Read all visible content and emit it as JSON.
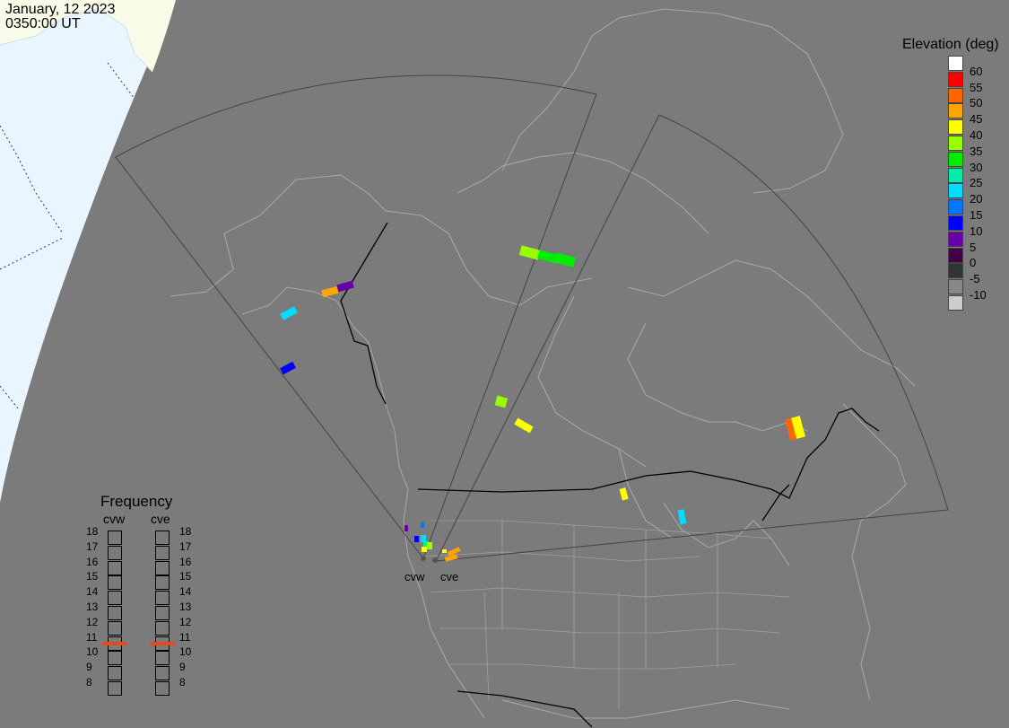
{
  "header": {
    "date": "January, 12 2023",
    "time": "0350:00 UT"
  },
  "elevation_legend": {
    "title": "Elevation (deg)",
    "items": [
      {
        "label": "60",
        "color": "#ffffff"
      },
      {
        "label": "55",
        "color": "#ff0000"
      },
      {
        "label": "50",
        "color": "#ff6600"
      },
      {
        "label": "45",
        "color": "#ffa500"
      },
      {
        "label": "40",
        "color": "#ffff00"
      },
      {
        "label": "35",
        "color": "#99ff00"
      },
      {
        "label": "30",
        "color": "#00ee00"
      },
      {
        "label": "25",
        "color": "#00eeaa"
      },
      {
        "label": "20",
        "color": "#00ddff"
      },
      {
        "label": "15",
        "color": "#0077ff"
      },
      {
        "label": "10",
        "color": "#0000ff"
      },
      {
        "label": "5",
        "color": "#6600aa"
      },
      {
        "label": "0",
        "color": "#440044"
      },
      {
        "label": "-5",
        "color": "#333333"
      },
      {
        "label": "-10",
        "color": "#888888"
      },
      {
        "label": "",
        "color": "#cccccc"
      }
    ]
  },
  "frequency_legend": {
    "title": "Frequency",
    "columns": [
      {
        "name": "cvw",
        "selected": "11"
      },
      {
        "name": "cve",
        "selected": "11"
      }
    ],
    "levels": [
      "18",
      "17",
      "16",
      "15",
      "14",
      "13",
      "12",
      "11",
      "10",
      "9",
      "8"
    ],
    "marker_color": "#e8481c"
  },
  "radars": [
    {
      "name": "cvw"
    },
    {
      "name": "cve"
    }
  ],
  "colors": {
    "night": "#7b7b7b",
    "sea_day": "#eaf6ff",
    "land_day": "#fafae8",
    "coast": "#a9a9a9",
    "border": "#000000"
  }
}
